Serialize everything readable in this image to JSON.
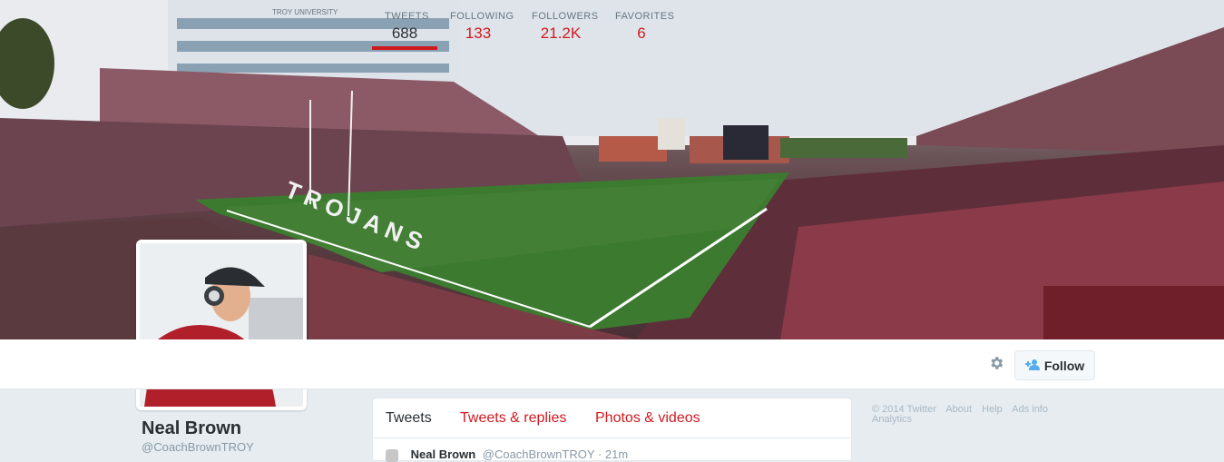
{
  "profile": {
    "name": "Neal Brown",
    "handle": "@CoachBrownTROY"
  },
  "stats": [
    {
      "label": "TWEETS",
      "value": "688"
    },
    {
      "label": "FOLLOWING",
      "value": "133"
    },
    {
      "label": "FOLLOWERS",
      "value": "21.2K"
    },
    {
      "label": "FAVORITES",
      "value": "6"
    }
  ],
  "actions": {
    "follow_label": "Follow",
    "follow_icon": "person-plus-icon",
    "settings_icon": "gear-icon"
  },
  "timeline": {
    "tabs": [
      {
        "label": "Tweets"
      },
      {
        "label": "Tweets & replies"
      },
      {
        "label": "Photos & videos"
      }
    ],
    "tweet": {
      "author": "Neal Brown",
      "handle": "@CoachBrownTROY",
      "separator": "·",
      "time": "21m"
    }
  },
  "footer": {
    "copyright": "© 2014 Twitter",
    "links": [
      "About",
      "Help",
      "Ads info",
      "Analytics"
    ]
  },
  "banner": {
    "field_text": "TROJANS",
    "stadium_text": "TROY UNIVERSITY"
  },
  "colors": {
    "accent": "#d0191f",
    "text": "#292f33",
    "muted": "#8899a6",
    "background": "#e6ecf0"
  }
}
